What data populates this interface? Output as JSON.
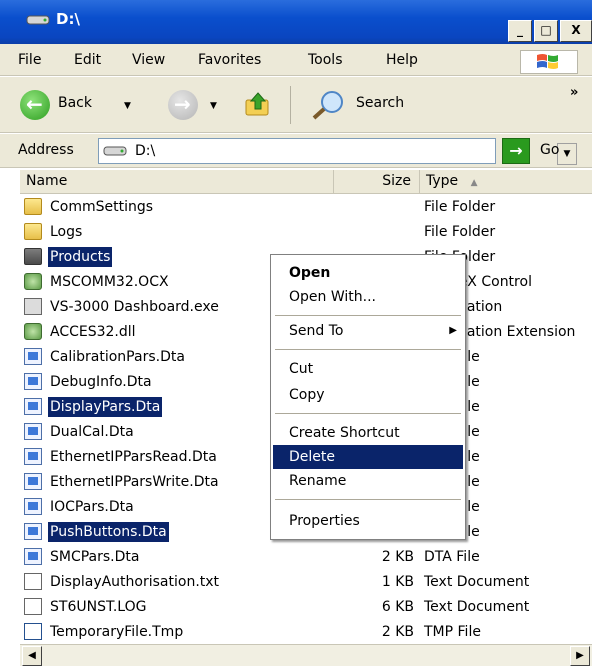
{
  "window": {
    "title": "D:\\",
    "min_label": "_",
    "max_label": "□",
    "close_label": "X"
  },
  "menu": [
    "File",
    "Edit",
    "View",
    "Favorites",
    "Tools",
    "Help"
  ],
  "toolbar": {
    "back_label": "Back",
    "search_label": "Search",
    "more": "»"
  },
  "address": {
    "label": "Address",
    "value": "D:\\",
    "go_label": "Go"
  },
  "columns": {
    "name": "Name",
    "size": "Size",
    "type": "Type"
  },
  "files": [
    {
      "name": "CommSettings",
      "size": "",
      "type": "File Folder",
      "icon": "folder-icon"
    },
    {
      "name": "Logs",
      "size": "",
      "type": "File Folder",
      "icon": "folder-icon"
    },
    {
      "name": "Products",
      "size": "",
      "type": "File Folder",
      "icon": "folder-icon"
    },
    {
      "name": "MSCOMM32.OCX",
      "size": "",
      "type": "ActiveX Control",
      "icon": "ocx-icon"
    },
    {
      "name": "VS-3000 Dashboard.exe",
      "size": "",
      "type": "Application",
      "icon": "exe-icon"
    },
    {
      "name": "ACCES32.dll",
      "size": "",
      "type": "Application Extension",
      "icon": "dll-icon"
    },
    {
      "name": "CalibrationPars.Dta",
      "size": "",
      "type": "DTA File",
      "icon": "dta-icon"
    },
    {
      "name": "DebugInfo.Dta",
      "size": "",
      "type": "DTA File",
      "icon": "dta-icon"
    },
    {
      "name": "DisplayPars.Dta",
      "size": "",
      "type": "DTA File",
      "icon": "dta-icon"
    },
    {
      "name": "DualCal.Dta",
      "size": "",
      "type": "DTA File",
      "icon": "dta-icon"
    },
    {
      "name": "EthernetIPParsRead.Dta",
      "size": "",
      "type": "DTA File",
      "icon": "dta-icon"
    },
    {
      "name": "EthernetIPParsWrite.Dta",
      "size": "",
      "type": "DTA File",
      "icon": "dta-icon"
    },
    {
      "name": "IOCPars.Dta",
      "size": "",
      "type": "DTA File",
      "icon": "dta-icon"
    },
    {
      "name": "PushButtons.Dta",
      "size": "",
      "type": "DTA File",
      "icon": "dta-icon"
    },
    {
      "name": "SMCPars.Dta",
      "size": "2 KB",
      "type": "DTA File",
      "icon": "dta-icon"
    },
    {
      "name": "DisplayAuthorisation.txt",
      "size": "1 KB",
      "type": "Text Document",
      "icon": "txt-icon"
    },
    {
      "name": "ST6UNST.LOG",
      "size": "6 KB",
      "type": "Text Document",
      "icon": "txt-icon"
    },
    {
      "name": "TemporaryFile.Tmp",
      "size": "2 KB",
      "type": "TMP File",
      "icon": "tmp-icon"
    }
  ],
  "context_menu": {
    "open": "Open",
    "open_with": "Open With...",
    "send_to": "Send To",
    "cut": "Cut",
    "copy": "Copy",
    "create_shortcut": "Create Shortcut",
    "delete": "Delete",
    "rename": "Rename",
    "properties": "Properties"
  }
}
